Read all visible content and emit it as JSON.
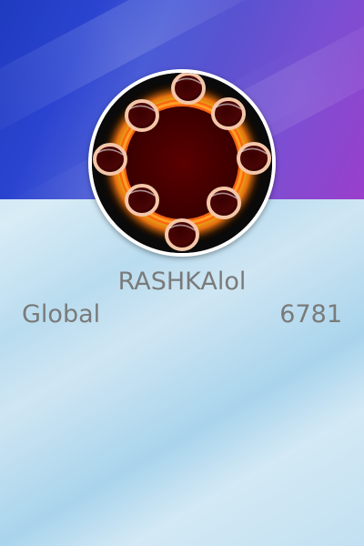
{
  "profile": {
    "username": "RASHKAlol",
    "avatar_icon": "cylinder-ring-icon"
  },
  "stats": {
    "rank_label": "Global",
    "rank_value": "6781"
  },
  "colors": {
    "header_gradient_start": "#1f3bbf",
    "header_gradient_end": "#9a3fcc",
    "body_background": "#cfe6f3",
    "text": "#7a7a7a"
  }
}
